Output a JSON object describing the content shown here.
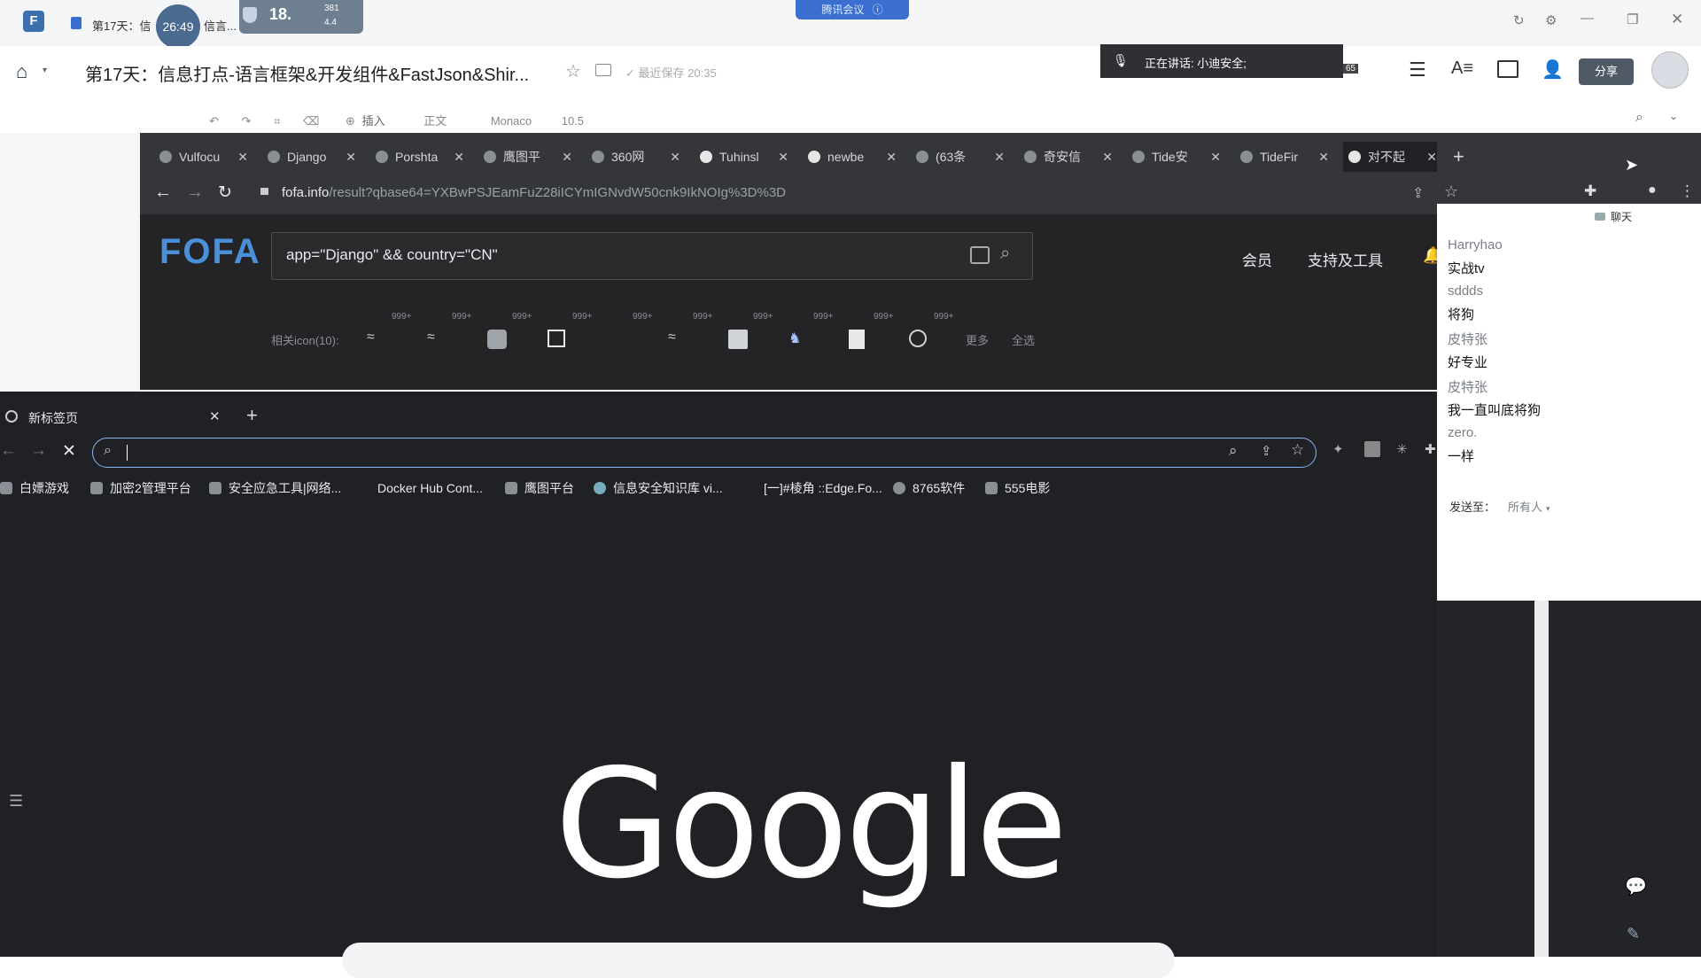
{
  "editor": {
    "doc_tab_title": "第17天：信",
    "doc_tab_suffix": "信言...",
    "timer": "26:49",
    "stats_main": "18.",
    "stats_up": "381",
    "stats_down": "4.4",
    "meeting_badge": "腾讯会议",
    "doc_title": "第17天：信息打点-语言框架&开发组件&FastJson&Shir...",
    "saved_status": "最近保存 20:35",
    "speaking": "正在讲话: 小迪安全;",
    "speaking_count": "65",
    "share_button": "分享",
    "toolbar": {
      "insert": "插入",
      "style": "正文",
      "font": "Monaco",
      "size": "10.5"
    }
  },
  "browser1": {
    "tabs": [
      {
        "label": "Vulfocu"
      },
      {
        "label": "Django"
      },
      {
        "label": "Porshta"
      },
      {
        "label": "鹰图平"
      },
      {
        "label": "360网"
      },
      {
        "label": "Tuhinsl"
      },
      {
        "label": "newbe"
      },
      {
        "label": "(63条"
      },
      {
        "label": "奇安信"
      },
      {
        "label": "Tide安"
      },
      {
        "label": "TideFir"
      },
      {
        "label": "对不起"
      }
    ],
    "url_host": "fofa.info",
    "url_path": "/result?qbase64=YXBwPSJEamFuZ28iICYmIGNvdW50cnk9IkNOIg%3D%3D",
    "logo": "FOFA",
    "query": "app=\"Django\" && country=\"CN\"",
    "nav_member": "会员",
    "nav_tools": "支持及工具",
    "related_label": "相关icon(10):",
    "related_count": "999+",
    "more": "更多",
    "select_all": "全选"
  },
  "chat": {
    "title": "聊天",
    "messages": [
      {
        "name": "Harryhao",
        "text": "实战tv"
      },
      {
        "name": "sddds",
        "text": "将狗"
      },
      {
        "name": "皮特张",
        "text": "好专业"
      },
      {
        "name": "皮特张",
        "text": "我一直叫底将狗"
      },
      {
        "name": "zero.",
        "text": "一样"
      }
    ],
    "send_to_label": "发送至：",
    "send_to_value": "所有人"
  },
  "browser2": {
    "tab_label": "新标签页",
    "bookmarks": [
      "白嫖游戏",
      "加密2管理平台",
      "安全应急工具|网络...",
      "Docker Hub Cont...",
      "鹰图平台",
      "信息安全知识库 vi...",
      "[一]#棱角 ::Edge.Fo...",
      "8765软件",
      "555电影"
    ],
    "google_logo": "Google"
  },
  "colors": {
    "accent": "#8ab4f8",
    "dark_bg": "#202124",
    "fofa_logo": "#4a8fd8"
  }
}
